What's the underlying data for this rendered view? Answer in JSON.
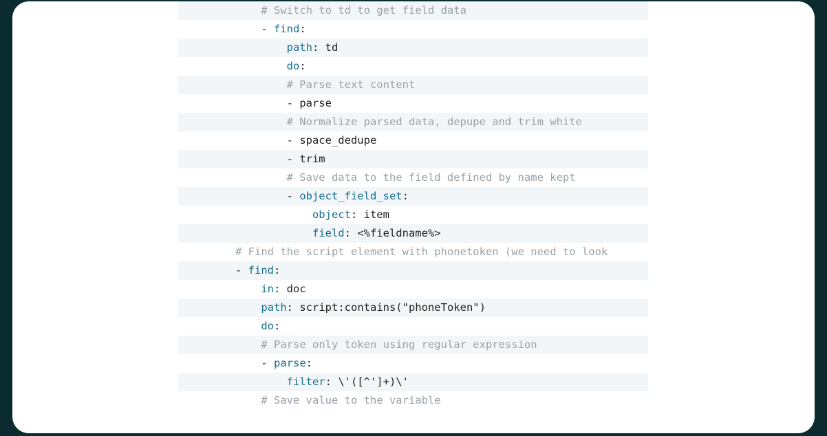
{
  "code": {
    "lines": [
      {
        "indent": 13,
        "type": "comment",
        "text": "# Switch to td to get field data"
      },
      {
        "indent": 13,
        "type": "item-key",
        "key": "find",
        "after": ":"
      },
      {
        "indent": 17,
        "type": "kv",
        "key": "path",
        "val": " td"
      },
      {
        "indent": 17,
        "type": "kv",
        "key": "do",
        "val": ""
      },
      {
        "indent": 17,
        "type": "comment",
        "text": "# Parse text content"
      },
      {
        "indent": 17,
        "type": "item-val",
        "val": "parse"
      },
      {
        "indent": 17,
        "type": "comment",
        "text": "# Normalize parsed data, depupe and trim white"
      },
      {
        "indent": 17,
        "type": "item-val",
        "val": "space_dedupe"
      },
      {
        "indent": 17,
        "type": "item-val",
        "val": "trim"
      },
      {
        "indent": 17,
        "type": "comment",
        "text": "# Save data to the field defined by name kept"
      },
      {
        "indent": 17,
        "type": "item-key",
        "key": "object_field_set",
        "after": ":"
      },
      {
        "indent": 21,
        "type": "kv",
        "key": "object",
        "val": " item"
      },
      {
        "indent": 21,
        "type": "kv",
        "key": "field",
        "val": " <%fieldname%>"
      },
      {
        "indent": 9,
        "type": "comment",
        "text": "# Find the script element with phonetoken (we need to look"
      },
      {
        "indent": 9,
        "type": "item-key",
        "key": "find",
        "after": ":"
      },
      {
        "indent": 13,
        "type": "kv",
        "key": "in",
        "val": " doc"
      },
      {
        "indent": 13,
        "type": "kv-plain",
        "key": "path",
        "val": " script:contains(\"phoneToken\")"
      },
      {
        "indent": 13,
        "type": "kv",
        "key": "do",
        "val": ""
      },
      {
        "indent": 13,
        "type": "comment",
        "text": "# Parse only token using regular expression"
      },
      {
        "indent": 13,
        "type": "item-key",
        "key": "parse",
        "after": ":"
      },
      {
        "indent": 17,
        "type": "kv-plain",
        "key": "filter",
        "val": " \\'([^']+)\\'"
      },
      {
        "indent": 13,
        "type": "comment",
        "text": "# Save value to the variable"
      }
    ]
  }
}
